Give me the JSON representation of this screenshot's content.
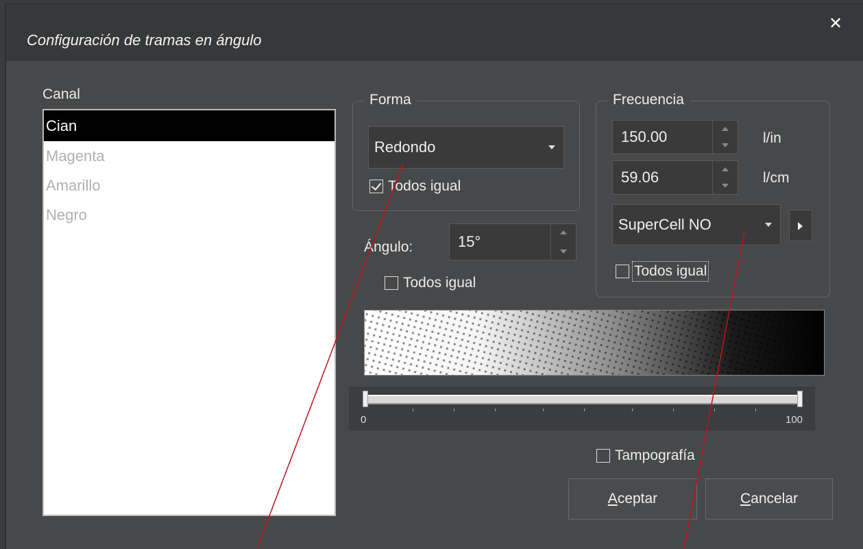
{
  "dialog": {
    "title": "Configuración de tramas en ángulo",
    "close_glyph": "✕"
  },
  "canal": {
    "label": "Canal",
    "items": [
      "Cian",
      "Magenta",
      "Amarillo",
      "Negro"
    ],
    "selected": "Cian"
  },
  "forma": {
    "legend": "Forma",
    "shape_value": "Redondo",
    "todos_igual": {
      "label": "Todos igual",
      "checked": true
    }
  },
  "angulo": {
    "label": "Ángulo:",
    "value": "15°",
    "todos_igual": {
      "label": "Todos igual",
      "checked": false
    }
  },
  "frecuencia": {
    "legend": "Frecuencia",
    "lpi_value": "150.00",
    "lpi_unit": "l/in",
    "lpcm_value": "59.06",
    "lpcm_unit": "l/cm",
    "supercell_value": "SuperCell NO",
    "todos_igual": {
      "label": "Todos igual",
      "checked": false
    }
  },
  "range": {
    "min_label": "0",
    "max_label": "100",
    "low": 0,
    "high": 100
  },
  "tampografia": {
    "label": "Tampografía",
    "checked": false
  },
  "buttons": {
    "accept_mnemonic": "A",
    "accept_rest": "ceptar",
    "cancel_mnemonic": "C",
    "cancel_rest": "ancelar"
  },
  "colors": {
    "dialog_bg": "#474849",
    "titlebar_bg": "#373839",
    "selection_bg": "#000000",
    "annotation_line": "#c0121e"
  }
}
